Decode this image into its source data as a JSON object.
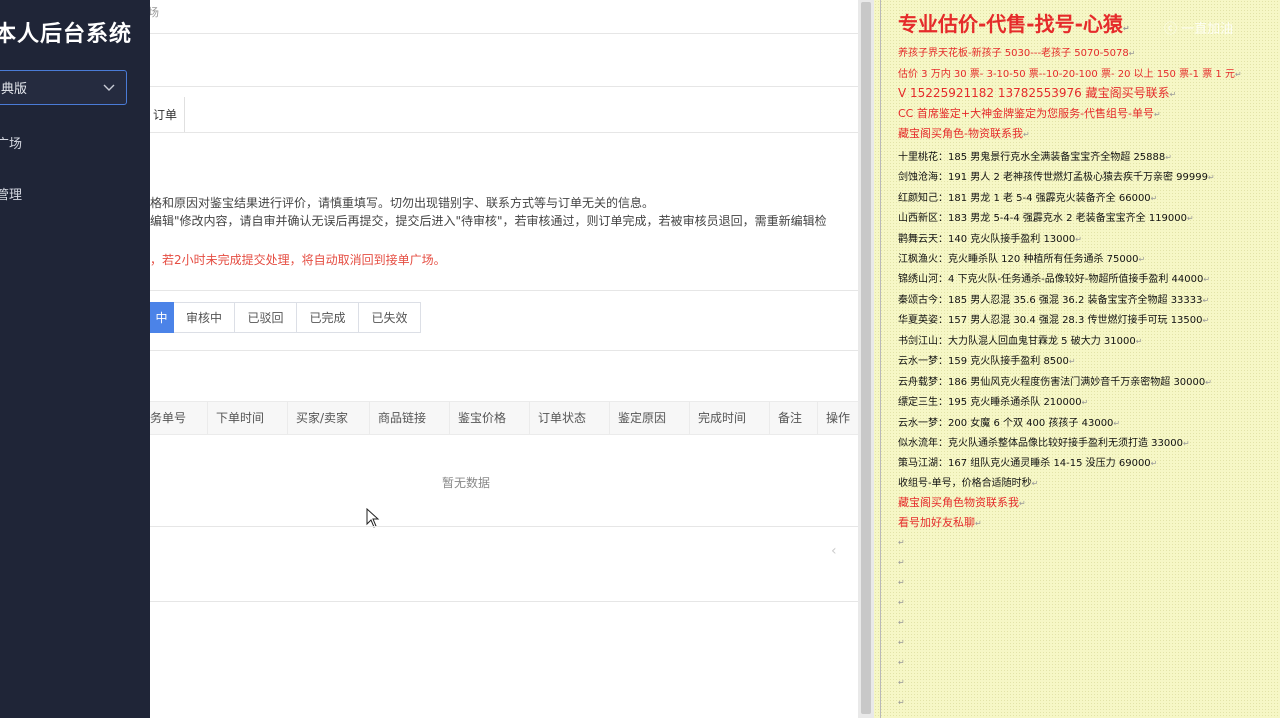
{
  "sidebar": {
    "title": "本人后台系统",
    "edition": "典版",
    "nav_items": [
      "广场",
      "管理"
    ]
  },
  "main": {
    "breadcrumb": "场",
    "tab_label": "订单",
    "notices": [
      "格和原因对鉴宝结果进行评价，请慎重填写。切勿出现错别字、联系方式等与订单无关的信息。",
      "编辑\"修改内容，请自审并确认无误后再提交，提交后进入\"待审核\"，若审核通过，则订单完成，若被审核员退回，需重新编辑检",
      "，若2小时未完成提交处理，将自动取消回到接单广场。"
    ],
    "status_buttons": [
      "中",
      "审核中",
      "已驳回",
      "已完成",
      "已失效"
    ],
    "table_headers": [
      "务单号",
      "下单时间",
      "买家/卖家",
      "商品链接",
      "鉴宝价格",
      "订单状态",
      "鉴定原因",
      "完成时间",
      "备注",
      "操作"
    ],
    "empty_text": "暂无数据",
    "pager_prev": "‹"
  },
  "note": {
    "headline": "专业估价-代售-找号-心猿",
    "watermark": "ⓒ 一直加油",
    "red_lines": [
      "养孩子界天花板-新孩子 5030---老孩子 5070-5078",
      "估价 3 万内 30 票- 3-10-50 票--10-20-100 票- 20 以上 150 票-1 票 1 元",
      "V 15225921182      13782553976    藏宝阁买号联系",
      "CC 首席鉴定+大神金牌鉴定为您服务-代售组号-单号",
      "藏宝阁买角色-物资联系我"
    ],
    "items": [
      "十里桃花：185 男鬼景行克水全满装备宝宝齐全物超 25888",
      "剑蚀沧海：191 男人 2 老神孩传世燃灯孟极心猿去疾千万亲密 99999",
      "红颜知己：181 男龙 1 老 5-4 强霹克火装备齐全 66000",
      "山西新区：183 男龙 5-4-4 强霹克水 2 老装备宝宝齐全 119000",
      "鹳舞云天：140 克火队接手盈利 13000",
      "江枫渔火：克火睡杀队 120 种植所有任务通杀 75000",
      "锦绣山河：4 下克火队-任务通杀-品像较好-物超所值接手盈利 44000",
      "秦颂古今：185 男人忍混 35.6 强混 36.2 装备宝宝齐全物超 33333",
      "华夏英姿：157 男人忍混 30.4 强混 28.3 传世燃灯接手可玩 13500",
      "书剑江山：大力队混人回血鬼甘霖龙 5 破大力 31000",
      "云水一梦：159 克火队接手盈利 8500",
      "云舟载梦：186 男仙风克火程度伤害法门满妙音千万亲密物超 30000",
      "缥定三生：195 克火睡杀通杀队 210000",
      "云水一梦：200 女魔 6 个双 400 孩孩子 43000",
      "似水流年：克火队通杀整体品像比较好接手盈利无须打造 33000",
      "策马江湖：167 组队克火通灵睡杀 14-15 没压力 69000",
      "收组号-单号，价格合适随时秒"
    ],
    "footer_lines": [
      "藏宝阁买角色物资联系我",
      "看号加好友私聊"
    ],
    "para_mark": "↵"
  }
}
